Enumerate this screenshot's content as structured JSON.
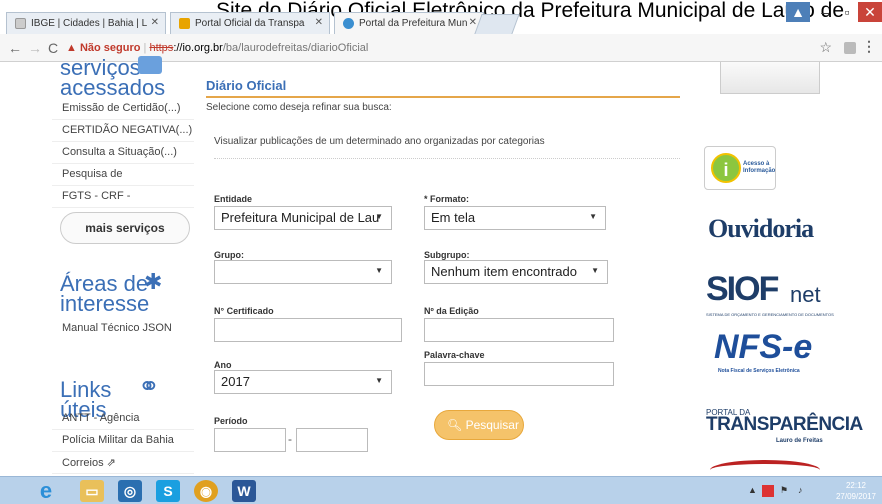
{
  "caption": "Site do Diário Oficial Eletrônico da Prefeitura Municipal de Lauro de",
  "browser": {
    "tabs": [
      {
        "label": "IBGE | Cidades | Bahia | L",
        "active": false
      },
      {
        "label": "Portal Oficial da Transpa",
        "active": false
      },
      {
        "label": "Portal da Prefeitura Mun",
        "active": true
      }
    ],
    "security": "▲ Não seguro",
    "url_scheme": "https",
    "url_host": "://io.org.br",
    "url_path": "/ba/laurodefreitas/diarioOficial"
  },
  "sidebar": {
    "heading1": "serviços acessados",
    "links": [
      "Emissão de Certidão(...)",
      "CERTIDÃO NEGATIVA(...)",
      "Consulta a Situação(...)",
      "Pesquisa de",
      "FGTS - CRF -"
    ],
    "more_button": "mais serviços",
    "heading2": "Áreas de interesse",
    "areas_links": [
      "Manual Técnico JSON"
    ],
    "heading3": "Links úteis",
    "util_links": [
      "ANTT - Agência",
      "Polícia Militar da Bahia",
      "Correios ⇗"
    ]
  },
  "main": {
    "title": "Diário Oficial",
    "instruction": "Selecione como deseja refinar sua busca:",
    "legend": "Visualizar publicações de um determinado ano organizadas por categorias",
    "entidade_label": "Entidade",
    "entidade_value": "Prefeitura Municipal de Lau",
    "formato_label": "* Formato:",
    "formato_value": "Em tela",
    "grupo_label": "Grupo:",
    "grupo_value": "",
    "subgrupo_label": "Subgrupo:",
    "subgrupo_value": "Nenhum item encontrado",
    "certificado_label": "N° Certificado",
    "edicao_label": "Nº da Edição",
    "palavra_label": "Palavra-chave",
    "ano_label": "Ano",
    "ano_value": "2017",
    "periodo_label": "Período",
    "search_button": "Pesquisar"
  },
  "right": {
    "acesso_text": "Acesso à Informação",
    "ouvidoria": "Ouvidoria",
    "siof_big": "SIOF",
    "siof_net": "net",
    "siof_small": "SISTEMA DE ORÇAMENTO E GERENCIAMENTO DE DOCUMENTOS",
    "nfse": "NFS-e",
    "nfse_sub": "Nota Fiscal de Serviços Eletrônica",
    "portal_small": "PORTAL DA",
    "transparencia": "TRANSPARÊNCIA",
    "lauro": "Lauro de Freitas"
  },
  "taskbar": {
    "time": "22:12",
    "date": "27/09/2017"
  }
}
